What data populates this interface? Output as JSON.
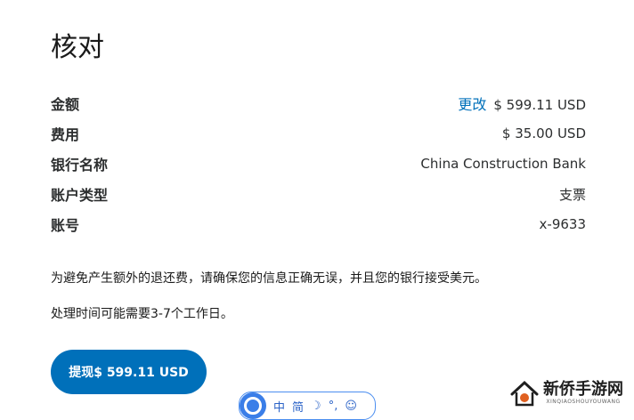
{
  "page": {
    "title": "核对"
  },
  "rows": [
    {
      "label": "金额",
      "change_link": "更改",
      "value": "$ 599.11 USD"
    },
    {
      "label": "费用",
      "value": "$ 35.00 USD"
    },
    {
      "label": "银行名称",
      "value": "China Construction Bank"
    },
    {
      "label": "账户类型",
      "value": "支票"
    },
    {
      "label": "账号",
      "value": "x-9633"
    }
  ],
  "notes": {
    "fees_notice": "为避免产生额外的退还费，请确保您的信息正确无误，并且您的银行接受美元。",
    "processing_time": "处理时间可能需要3-7个工作日。"
  },
  "withdraw_button": {
    "label": "提现$ 599.11 USD"
  },
  "ime_toolbar": {
    "mode": "中",
    "punct": "简"
  },
  "watermark": {
    "main": "新侨手游网",
    "sub": "XINQIAOSHOUYOUWANG"
  },
  "colors": {
    "accent": "#0070ba",
    "text": "#2c2e2f"
  }
}
